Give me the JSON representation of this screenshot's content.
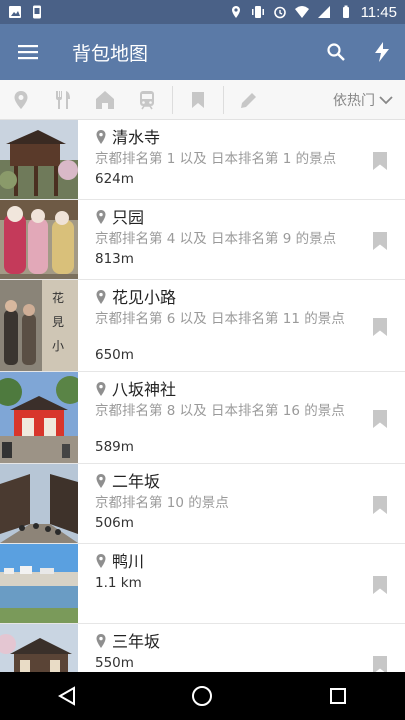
{
  "status": {
    "time": "11:45"
  },
  "appbar": {
    "title": "背包地图"
  },
  "filters": {
    "sort_label": "依热门"
  },
  "list": [
    {
      "name": "清水寺",
      "desc": "京都排名第 1 以及 日本排名第 1 的景点",
      "dist": "624m"
    },
    {
      "name": "只园",
      "desc": "京都排名第 4 以及 日本排名第 9 的景点",
      "dist": "813m"
    },
    {
      "name": "花见小路",
      "desc": "京都排名第 6 以及 日本排名第 11 的景点",
      "dist": "650m"
    },
    {
      "name": "八坂神社",
      "desc": "京都排名第 8 以及 日本排名第 16 的景点",
      "dist": "589m"
    },
    {
      "name": "二年坂",
      "desc": "京都排名第 10 的景点",
      "dist": "506m"
    },
    {
      "name": "鸭川",
      "desc": "",
      "dist": "1.1 km"
    },
    {
      "name": "三年坂",
      "desc": "",
      "dist": "550m"
    }
  ],
  "colors": {
    "appbar": "#5b7aa7",
    "statusbar": "#4a6187"
  }
}
